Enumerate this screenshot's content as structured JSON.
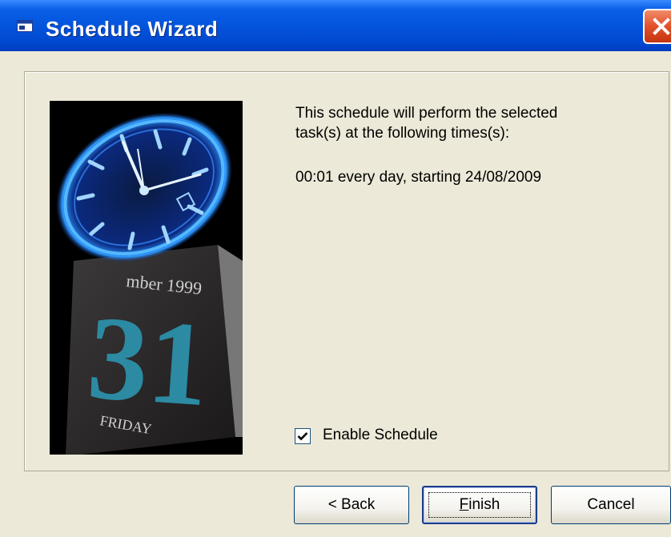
{
  "window": {
    "title": "Schedule Wizard",
    "app_icon": "window-icon",
    "close_icon": "close-icon"
  },
  "content": {
    "description_line1": "This schedule will perform the selected",
    "description_line2": "task(s) at the following times(s):",
    "schedule_time": "00:01 every day, starting 24/08/2009",
    "image_texts": {
      "date_line": "mber 1999",
      "day_number": "31",
      "weekday": "FRIDAY"
    }
  },
  "enable_schedule": {
    "label": "Enable Schedule",
    "checked": true
  },
  "buttons": {
    "back": "< Back",
    "finish_underline": "F",
    "finish_rest": "inish",
    "cancel": "Cancel"
  },
  "colors": {
    "titlebar": "#0355dc",
    "dialog_bg": "#ECE9D8",
    "close_button": "#e2512a",
    "clock_glow": "#1f7cff",
    "calendar_digits": "#2c8aa3"
  }
}
